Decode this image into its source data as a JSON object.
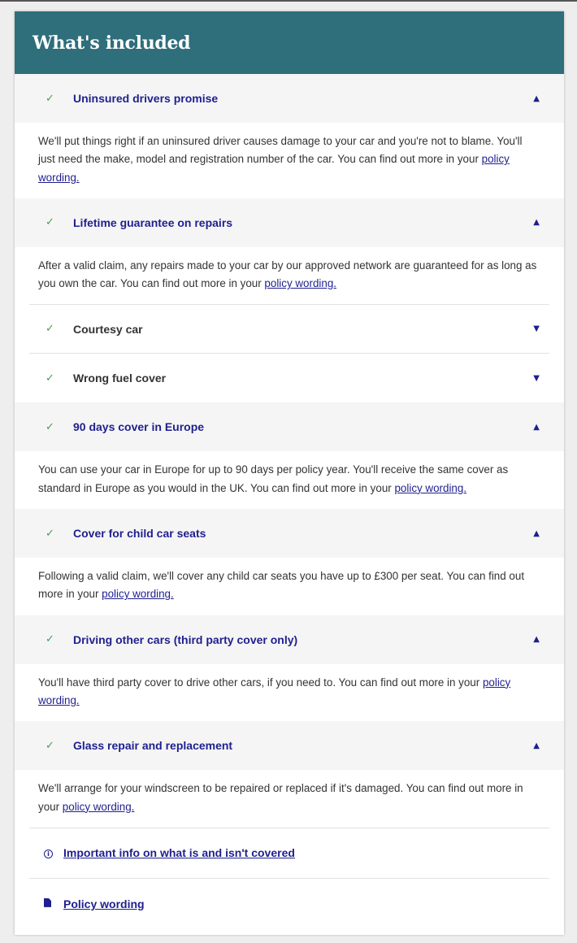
{
  "header": {
    "title": "What's included"
  },
  "items": [
    {
      "title": "Uninsured drivers promise",
      "state": "open",
      "text": "We'll put things right if an uninsured driver causes damage to your car and you're not to blame. You'll just need the make, model and registration number of the car. You can find out more in your",
      "link": "policy wording."
    },
    {
      "title": "Lifetime guarantee on repairs",
      "state": "open",
      "text": "After a valid claim, any repairs made to your car by our approved network are guaranteed for as long as you own the car. You can find out more in your",
      "link": "policy wording."
    },
    {
      "title": "Courtesy car",
      "state": "closed"
    },
    {
      "title": "Wrong fuel cover",
      "state": "closed"
    },
    {
      "title": "90 days cover in Europe",
      "state": "open",
      "text": "You can use your car in Europe for up to 90 days per policy year. You'll receive the same cover as standard in Europe as you would in the UK. You can find out more in your",
      "link": "policy wording."
    },
    {
      "title": "Cover for child car seats",
      "state": "open",
      "text": "Following a valid claim, we'll cover any child car seats you have up to £300 per seat. You can find out more in your",
      "link": "policy wording."
    },
    {
      "title": "Driving other cars (third party cover only)",
      "state": "open",
      "text": "You'll have third party cover to drive other cars, if you need to. You can find out more in your",
      "link": "policy wording."
    },
    {
      "title": "Glass repair and replacement",
      "state": "open",
      "text": "We'll arrange for your windscreen to be repaired or replaced if it's damaged. You can find out more in your",
      "link": "policy wording."
    }
  ],
  "icons": {
    "check": "check-icon",
    "expanded": "chevron-up-icon",
    "collapsed": "chevron-down-icon"
  },
  "footer": {
    "important_info": "Important info on what is and isn't covered",
    "policy_wording": "Policy wording"
  },
  "colors": {
    "header_bg": "#2f6e7b",
    "link": "#1f1f8f",
    "check": "#4a9a58"
  }
}
